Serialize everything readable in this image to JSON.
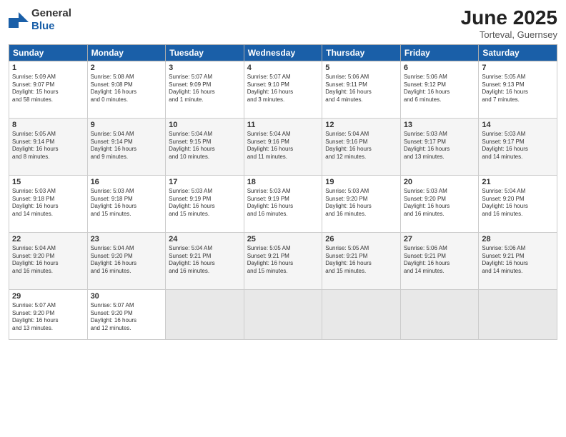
{
  "header": {
    "logo_general": "General",
    "logo_blue": "Blue",
    "month_title": "June 2025",
    "location": "Torteval, Guernsey"
  },
  "days_of_week": [
    "Sunday",
    "Monday",
    "Tuesday",
    "Wednesday",
    "Thursday",
    "Friday",
    "Saturday"
  ],
  "weeks": [
    [
      {
        "day": "1",
        "info": "Sunrise: 5:09 AM\nSunset: 9:07 PM\nDaylight: 15 hours\nand 58 minutes."
      },
      {
        "day": "2",
        "info": "Sunrise: 5:08 AM\nSunset: 9:08 PM\nDaylight: 16 hours\nand 0 minutes."
      },
      {
        "day": "3",
        "info": "Sunrise: 5:07 AM\nSunset: 9:09 PM\nDaylight: 16 hours\nand 1 minute."
      },
      {
        "day": "4",
        "info": "Sunrise: 5:07 AM\nSunset: 9:10 PM\nDaylight: 16 hours\nand 3 minutes."
      },
      {
        "day": "5",
        "info": "Sunrise: 5:06 AM\nSunset: 9:11 PM\nDaylight: 16 hours\nand 4 minutes."
      },
      {
        "day": "6",
        "info": "Sunrise: 5:06 AM\nSunset: 9:12 PM\nDaylight: 16 hours\nand 6 minutes."
      },
      {
        "day": "7",
        "info": "Sunrise: 5:05 AM\nSunset: 9:13 PM\nDaylight: 16 hours\nand 7 minutes."
      }
    ],
    [
      {
        "day": "8",
        "info": "Sunrise: 5:05 AM\nSunset: 9:14 PM\nDaylight: 16 hours\nand 8 minutes."
      },
      {
        "day": "9",
        "info": "Sunrise: 5:04 AM\nSunset: 9:14 PM\nDaylight: 16 hours\nand 9 minutes."
      },
      {
        "day": "10",
        "info": "Sunrise: 5:04 AM\nSunset: 9:15 PM\nDaylight: 16 hours\nand 10 minutes."
      },
      {
        "day": "11",
        "info": "Sunrise: 5:04 AM\nSunset: 9:16 PM\nDaylight: 16 hours\nand 11 minutes."
      },
      {
        "day": "12",
        "info": "Sunrise: 5:04 AM\nSunset: 9:16 PM\nDaylight: 16 hours\nand 12 minutes."
      },
      {
        "day": "13",
        "info": "Sunrise: 5:03 AM\nSunset: 9:17 PM\nDaylight: 16 hours\nand 13 minutes."
      },
      {
        "day": "14",
        "info": "Sunrise: 5:03 AM\nSunset: 9:17 PM\nDaylight: 16 hours\nand 14 minutes."
      }
    ],
    [
      {
        "day": "15",
        "info": "Sunrise: 5:03 AM\nSunset: 9:18 PM\nDaylight: 16 hours\nand 14 minutes."
      },
      {
        "day": "16",
        "info": "Sunrise: 5:03 AM\nSunset: 9:18 PM\nDaylight: 16 hours\nand 15 minutes."
      },
      {
        "day": "17",
        "info": "Sunrise: 5:03 AM\nSunset: 9:19 PM\nDaylight: 16 hours\nand 15 minutes."
      },
      {
        "day": "18",
        "info": "Sunrise: 5:03 AM\nSunset: 9:19 PM\nDaylight: 16 hours\nand 16 minutes."
      },
      {
        "day": "19",
        "info": "Sunrise: 5:03 AM\nSunset: 9:20 PM\nDaylight: 16 hours\nand 16 minutes."
      },
      {
        "day": "20",
        "info": "Sunrise: 5:03 AM\nSunset: 9:20 PM\nDaylight: 16 hours\nand 16 minutes."
      },
      {
        "day": "21",
        "info": "Sunrise: 5:04 AM\nSunset: 9:20 PM\nDaylight: 16 hours\nand 16 minutes."
      }
    ],
    [
      {
        "day": "22",
        "info": "Sunrise: 5:04 AM\nSunset: 9:20 PM\nDaylight: 16 hours\nand 16 minutes."
      },
      {
        "day": "23",
        "info": "Sunrise: 5:04 AM\nSunset: 9:20 PM\nDaylight: 16 hours\nand 16 minutes."
      },
      {
        "day": "24",
        "info": "Sunrise: 5:04 AM\nSunset: 9:21 PM\nDaylight: 16 hours\nand 16 minutes."
      },
      {
        "day": "25",
        "info": "Sunrise: 5:05 AM\nSunset: 9:21 PM\nDaylight: 16 hours\nand 15 minutes."
      },
      {
        "day": "26",
        "info": "Sunrise: 5:05 AM\nSunset: 9:21 PM\nDaylight: 16 hours\nand 15 minutes."
      },
      {
        "day": "27",
        "info": "Sunrise: 5:06 AM\nSunset: 9:21 PM\nDaylight: 16 hours\nand 14 minutes."
      },
      {
        "day": "28",
        "info": "Sunrise: 5:06 AM\nSunset: 9:21 PM\nDaylight: 16 hours\nand 14 minutes."
      }
    ],
    [
      {
        "day": "29",
        "info": "Sunrise: 5:07 AM\nSunset: 9:20 PM\nDaylight: 16 hours\nand 13 minutes."
      },
      {
        "day": "30",
        "info": "Sunrise: 5:07 AM\nSunset: 9:20 PM\nDaylight: 16 hours\nand 12 minutes."
      },
      {
        "day": "",
        "info": ""
      },
      {
        "day": "",
        "info": ""
      },
      {
        "day": "",
        "info": ""
      },
      {
        "day": "",
        "info": ""
      },
      {
        "day": "",
        "info": ""
      }
    ]
  ]
}
